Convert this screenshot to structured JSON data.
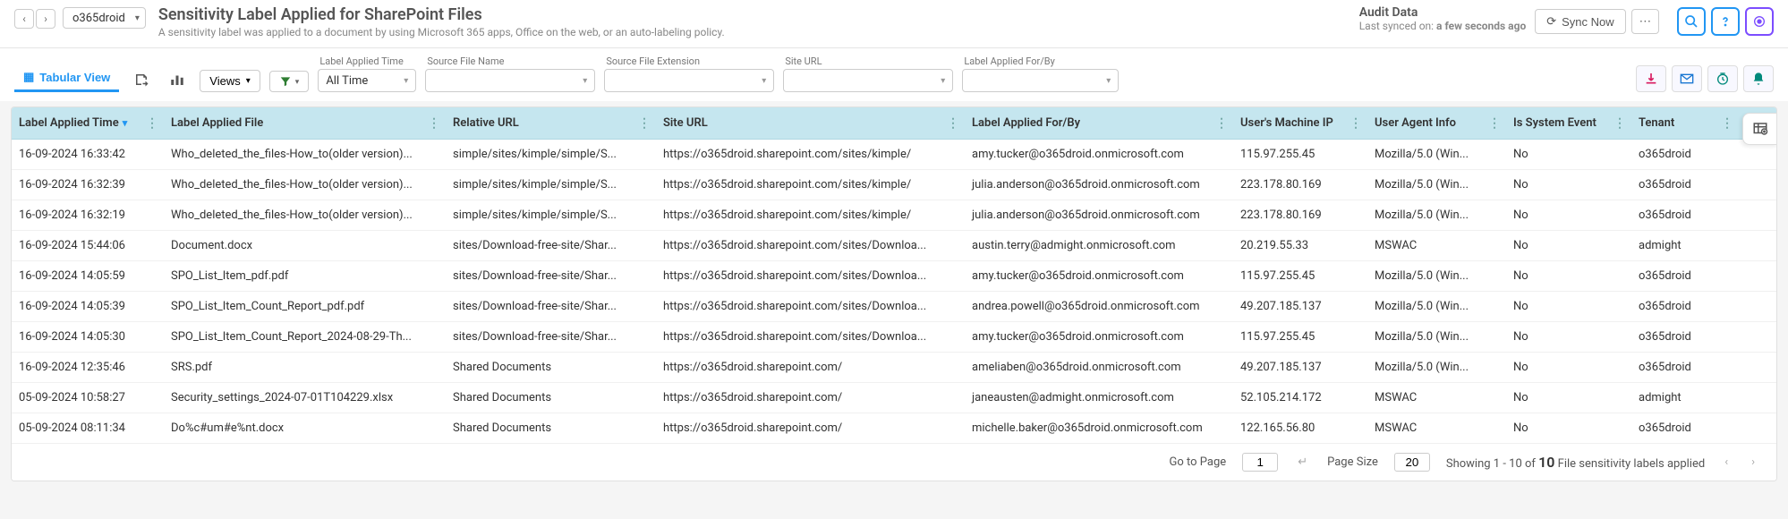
{
  "header": {
    "tenant_selected": "o365droid",
    "title": "Sensitivity Label Applied for SharePoint Files",
    "subtitle": "A sensitivity label was applied to a document by using Microsoft 365 apps, Office on the web, or an auto-labeling policy.",
    "audit_title": "Audit Data",
    "audit_sub_prefix": "Last synced on: ",
    "audit_sub_value": "a few seconds ago",
    "sync_label": "Sync Now"
  },
  "toolbar": {
    "tabular_view": "Tabular View",
    "views_label": "Views",
    "filters": {
      "label_applied_time": {
        "label": "Label Applied Time",
        "value": "All Time"
      },
      "source_file_name": {
        "label": "Source File Name",
        "value": ""
      },
      "source_file_ext": {
        "label": "Source File Extension",
        "value": ""
      },
      "site_url": {
        "label": "Site URL",
        "value": ""
      },
      "label_applied_for_by": {
        "label": "Label Applied For/By",
        "value": ""
      }
    }
  },
  "columns": [
    "Label Applied Time",
    "Label Applied File",
    "Relative URL",
    "Site URL",
    "Label Applied For/By",
    "User's Machine IP",
    "User Agent Info",
    "Is System Event",
    "Tenant"
  ],
  "rows": [
    {
      "c0": "16-09-2024 16:33:42",
      "c1": "Who_deleted_the_files-How_to(older version)...",
      "c2": "simple/sites/kimple/simple/S...",
      "c3": "https://o365droid.sharepoint.com/sites/kimple/",
      "c4": "amy.tucker@o365droid.onmicrosoft.com",
      "c5": "115.97.255.45",
      "c6": "Mozilla/5.0 (Win...",
      "c7": "No",
      "c8": "o365droid"
    },
    {
      "c0": "16-09-2024 16:32:39",
      "c1": "Who_deleted_the_files-How_to(older version)...",
      "c2": "simple/sites/kimple/simple/S...",
      "c3": "https://o365droid.sharepoint.com/sites/kimple/",
      "c4": "julia.anderson@o365droid.onmicrosoft.com",
      "c5": "223.178.80.169",
      "c6": "Mozilla/5.0 (Win...",
      "c7": "No",
      "c8": "o365droid"
    },
    {
      "c0": "16-09-2024 16:32:19",
      "c1": "Who_deleted_the_files-How_to(older version)...",
      "c2": "simple/sites/kimple/simple/S...",
      "c3": "https://o365droid.sharepoint.com/sites/kimple/",
      "c4": "julia.anderson@o365droid.onmicrosoft.com",
      "c5": "223.178.80.169",
      "c6": "Mozilla/5.0 (Win...",
      "c7": "No",
      "c8": "o365droid"
    },
    {
      "c0": "16-09-2024 15:44:06",
      "c1": "Document.docx",
      "c2": "sites/Download-free-site/Shar...",
      "c3": "https://o365droid.sharepoint.com/sites/Downloa...",
      "c4": "austin.terry@admight.onmicrosoft.com",
      "c5": "20.219.55.33",
      "c6": "MSWAC",
      "c7": "No",
      "c8": "admight"
    },
    {
      "c0": "16-09-2024 14:05:59",
      "c1": "SPO_List_Item_pdf.pdf",
      "c2": "sites/Download-free-site/Shar...",
      "c3": "https://o365droid.sharepoint.com/sites/Downloa...",
      "c4": "amy.tucker@o365droid.onmicrosoft.com",
      "c5": "115.97.255.45",
      "c6": "Mozilla/5.0 (Win...",
      "c7": "No",
      "c8": "o365droid"
    },
    {
      "c0": "16-09-2024 14:05:39",
      "c1": "SPO_List_Item_Count_Report_pdf.pdf",
      "c2": "sites/Download-free-site/Shar...",
      "c3": "https://o365droid.sharepoint.com/sites/Downloa...",
      "c4": "andrea.powell@o365droid.onmicrosoft.com",
      "c5": "49.207.185.137",
      "c6": "Mozilla/5.0 (Win...",
      "c7": "No",
      "c8": "o365droid"
    },
    {
      "c0": "16-09-2024 14:05:30",
      "c1": "SPO_List_Item_Count_Report_2024-08-29-Th...",
      "c2": "sites/Download-free-site/Shar...",
      "c3": "https://o365droid.sharepoint.com/sites/Downloa...",
      "c4": "amy.tucker@o365droid.onmicrosoft.com",
      "c5": "115.97.255.45",
      "c6": "Mozilla/5.0 (Win...",
      "c7": "No",
      "c8": "o365droid"
    },
    {
      "c0": "16-09-2024 12:35:46",
      "c1": "SRS.pdf",
      "c2": "Shared Documents",
      "c3": "https://o365droid.sharepoint.com/",
      "c4": "ameliaben@o365droid.onmicrosoft.com",
      "c5": "49.207.185.137",
      "c6": "Mozilla/5.0 (Win...",
      "c7": "No",
      "c8": "o365droid"
    },
    {
      "c0": "05-09-2024 10:58:27",
      "c1": "Security_settings_2024-07-01T104229.xlsx",
      "c2": "Shared Documents",
      "c3": "https://o365droid.sharepoint.com/",
      "c4": "janeausten@admight.onmicrosoft.com",
      "c5": "52.105.214.172",
      "c6": "MSWAC",
      "c7": "No",
      "c8": "admight"
    },
    {
      "c0": "05-09-2024 08:11:34",
      "c1": "Do%c#um#e%nt.docx",
      "c2": "Shared Documents",
      "c3": "https://o365droid.sharepoint.com/",
      "c4": "michelle.baker@o365droid.onmicrosoft.com",
      "c5": "122.165.56.80",
      "c6": "MSWAC",
      "c7": "No",
      "c8": "o365droid"
    }
  ],
  "footer": {
    "goto_label": "Go to Page",
    "goto_value": "1",
    "pagesize_label": "Page Size",
    "pagesize_value": "20",
    "showing_prefix": "Showing 1 - 10 of",
    "total": "10",
    "showing_suffix": "File sensitivity labels applied"
  }
}
